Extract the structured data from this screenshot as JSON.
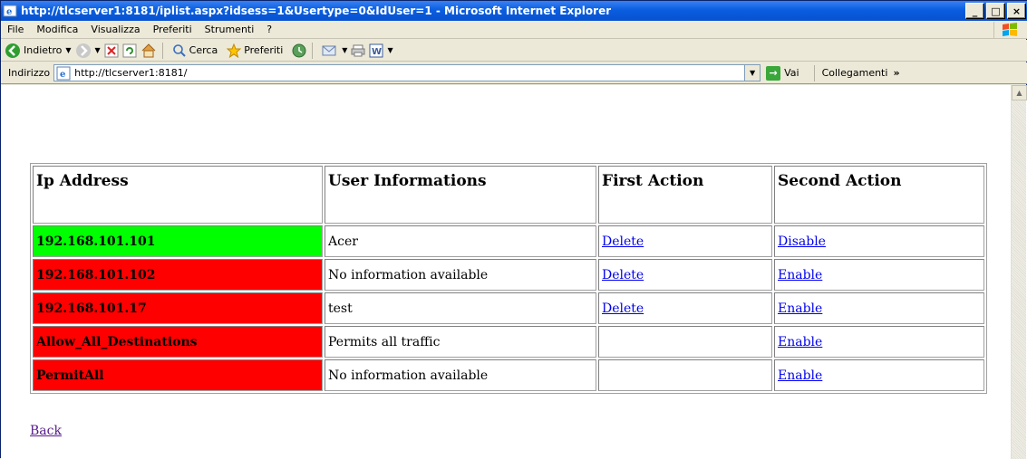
{
  "window": {
    "title": "http://tlcserver1:8181/iplist.aspx?idsess=1&Usertype=0&IdUser=1 - Microsoft Internet Explorer",
    "buttons": {
      "minimize": "_",
      "maximize": "□",
      "close": "×"
    }
  },
  "menubar": {
    "items": [
      "File",
      "Modifica",
      "Visualizza",
      "Preferiti",
      "Strumenti",
      "?"
    ]
  },
  "toolbar": {
    "back_label": "Indietro",
    "search_label": "Cerca",
    "favorites_label": "Preferiti"
  },
  "addressbar": {
    "label": "Indirizzo",
    "value": "http://tlcserver1:8181/",
    "go_label": "Vai",
    "links_label": "Collegamenti",
    "links_more": "»"
  },
  "table": {
    "headers": [
      "Ip Address",
      "User Informations",
      "First Action",
      "Second Action"
    ],
    "rows": [
      {
        "ip": "192.168.101.101",
        "info": "Acer",
        "first": "Delete",
        "second": "Disable",
        "status_color": "#00ff00"
      },
      {
        "ip": "192.168.101.102",
        "info": "No information available",
        "first": "Delete",
        "second": "Enable",
        "status_color": "#ff0000"
      },
      {
        "ip": "192.168.101.17",
        "info": "test",
        "first": "Delete",
        "second": "Enable",
        "status_color": "#ff0000"
      },
      {
        "ip": "Allow_All_Destinations",
        "info": "Permits all traffic",
        "first": "",
        "second": "Enable",
        "status_color": "#ff0000"
      },
      {
        "ip": "PermitAll",
        "info": "No information available",
        "first": "",
        "second": "Enable",
        "status_color": "#ff0000"
      }
    ]
  },
  "back_link": "Back",
  "colors": {
    "enabled": "#00ff00",
    "disabled": "#ff0000",
    "link": "#0000ee",
    "visited": "#551a8b"
  }
}
